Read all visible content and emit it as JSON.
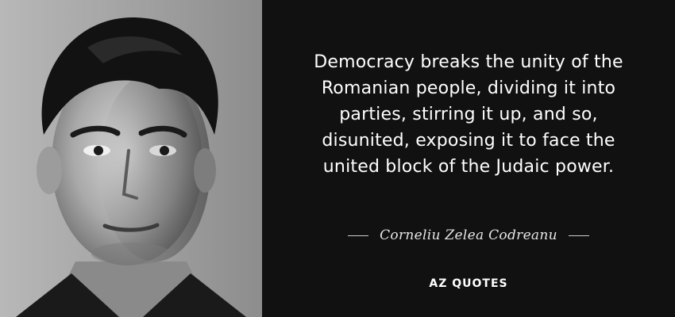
{
  "quote": {
    "lines": [
      "Democracy breaks the unity of the",
      "Romanian people, dividing it into",
      "parties, stirring it up, and so,",
      "disunited, exposing it to face the",
      "united block of the Judaic power."
    ]
  },
  "author": {
    "name": "Corneliu Zelea Codreanu"
  },
  "brand": {
    "logo_text": "AZ QUOTES"
  },
  "colors": {
    "background": "#111111",
    "text": "#ffffff",
    "portrait": "grayscale"
  }
}
